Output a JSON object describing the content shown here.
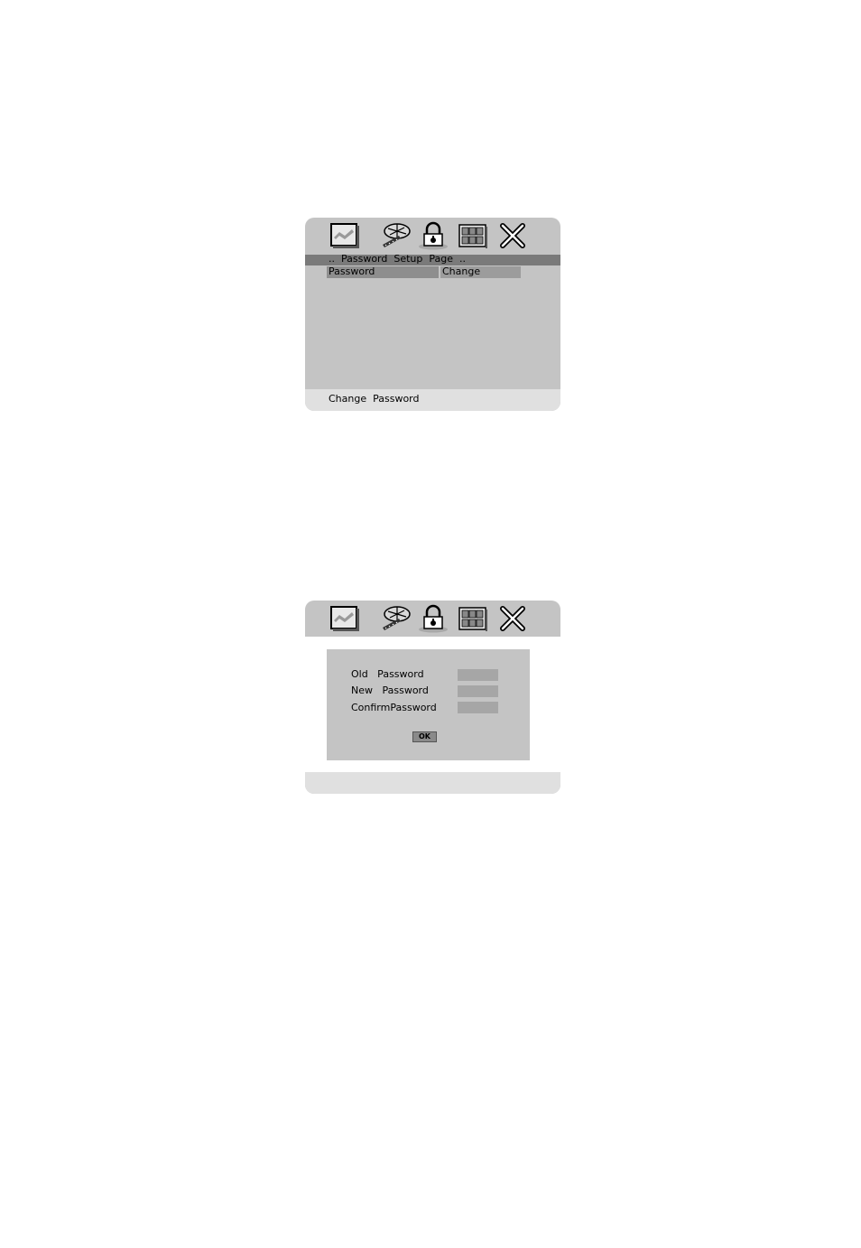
{
  "panel_1": {
    "icons": [
      "general-setup-icon",
      "audio-setup-icon",
      "password-lock-icon",
      "preference-icon",
      "exit-icon"
    ],
    "title": "..  Password  Setup  Page  ..",
    "item": {
      "label": "Password",
      "value": "Change"
    },
    "status": "Change  Password"
  },
  "panel_2": {
    "icons": [
      "general-setup-icon",
      "audio-setup-icon",
      "password-lock-icon",
      "preference-icon",
      "exit-icon"
    ],
    "fields": [
      {
        "label": "Old   Password",
        "value": ""
      },
      {
        "label": "New   Password",
        "value": ""
      },
      {
        "label": "ConfirmPassword",
        "value": ""
      }
    ],
    "ok_label": "OK",
    "status": ""
  }
}
